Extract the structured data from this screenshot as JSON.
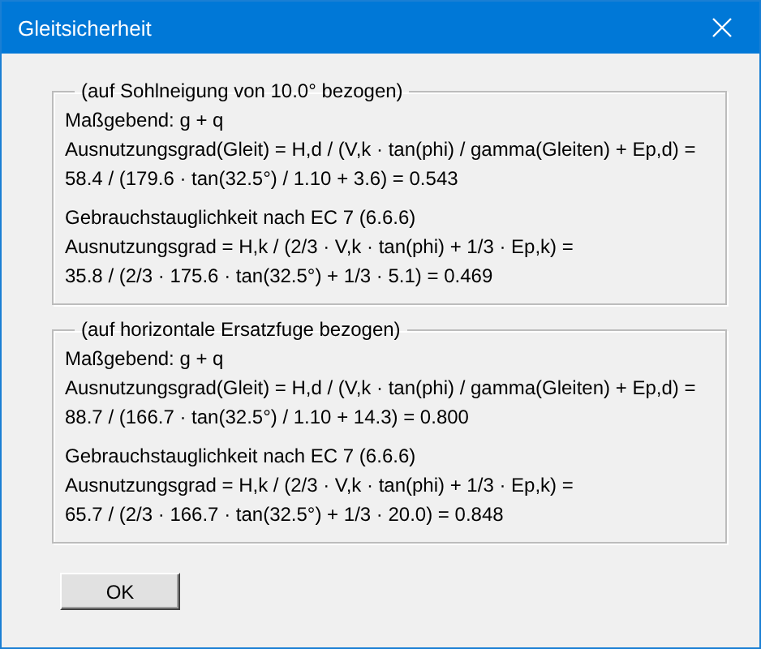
{
  "window": {
    "title": "Gleitsicherheit"
  },
  "groups": [
    {
      "legend": "(auf Sohlneigung von 10.0° bezogen)",
      "paragraphs": [
        [
          "Maßgebend: g + q",
          "Ausnutzungsgrad(Gleit) = H,d / (V,k · tan(phi) / gamma(Gleiten) + Ep,d) =",
          "58.4 / (179.6 · tan(32.5°) / 1.10 + 3.6) = 0.543"
        ],
        [
          "Gebrauchstauglichkeit nach EC 7 (6.6.6)",
          "Ausnutzungsgrad = H,k / (2/3 · V,k · tan(phi) + 1/3 · Ep,k) =",
          "35.8 / (2/3 · 175.6 · tan(32.5°) + 1/3 · 5.1) = 0.469"
        ]
      ]
    },
    {
      "legend": "(auf horizontale Ersatzfuge bezogen)",
      "paragraphs": [
        [
          "Maßgebend: g + q",
          "Ausnutzungsgrad(Gleit) = H,d / (V,k · tan(phi) / gamma(Gleiten) + Ep,d) =",
          "88.7 / (166.7 · tan(32.5°) / 1.10 + 14.3) = 0.800"
        ],
        [
          "Gebrauchstauglichkeit nach EC 7 (6.6.6)",
          "Ausnutzungsgrad = H,k / (2/3 · V,k · tan(phi) + 1/3 · Ep,k) =",
          "65.7 / (2/3 · 166.7 · tan(32.5°) + 1/3 · 20.0) = 0.848"
        ]
      ]
    }
  ],
  "button": {
    "label": "OK"
  }
}
